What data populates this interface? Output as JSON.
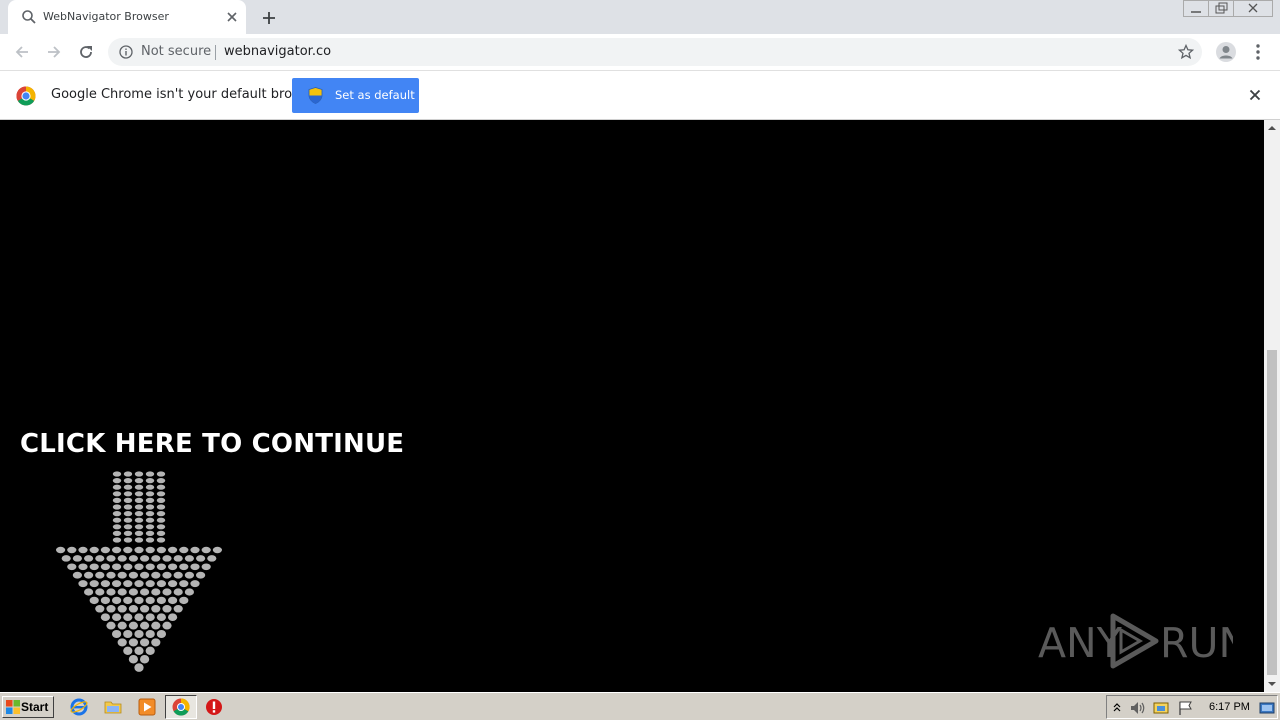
{
  "browser": {
    "tab_title": "WebNavigator Browser",
    "security_label": "Not secure",
    "url": "webnavigator.co"
  },
  "infobar": {
    "message": "Google Chrome isn't your default browser",
    "button_label": "Set as default"
  },
  "page": {
    "cta_text": "CLICK HERE TO CONTINUE",
    "watermark_left": "ANY",
    "watermark_right": "RUN"
  },
  "taskbar": {
    "start_label": "Start",
    "clock": "6:17 PM",
    "apps": [
      "internet-explorer-icon",
      "folder-icon",
      "media-player-icon",
      "chrome-icon",
      "stop-icon"
    ]
  },
  "colors": {
    "accent": "#4285f4",
    "page_bg": "#000000",
    "taskbar": "#d4d0c8"
  }
}
